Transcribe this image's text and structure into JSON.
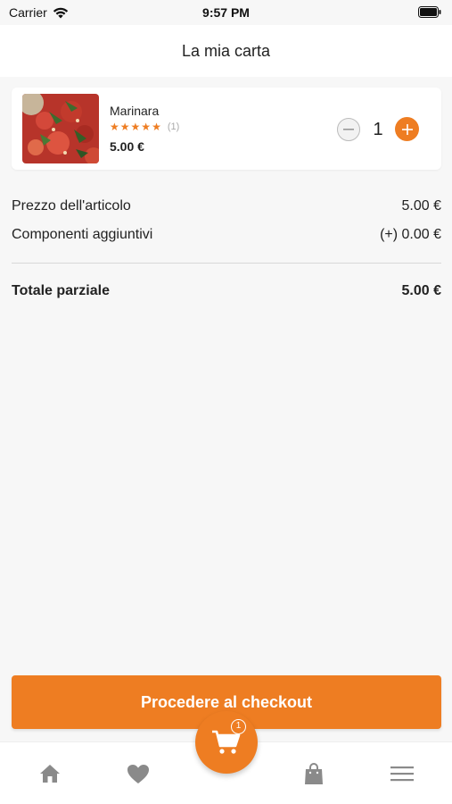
{
  "status_bar": {
    "carrier": "Carrier",
    "time": "9:57 PM"
  },
  "header": {
    "title": "La mia carta"
  },
  "cart_items": [
    {
      "name": "Marinara",
      "rating": 5,
      "reviews": "(1)",
      "price": "5.00 €",
      "quantity": "1"
    }
  ],
  "summary": {
    "item_price_label": "Prezzo dell'articolo",
    "item_price_value": "5.00 €",
    "extras_label": "Componenti aggiuntivi",
    "extras_value": "(+) 0.00 €",
    "subtotal_label": "Totale parziale",
    "subtotal_value": "5.00 €"
  },
  "checkout": {
    "label": "Procedere al checkout"
  },
  "tab_bar": {
    "items": [
      "home-icon",
      "heart-icon",
      "cart-icon",
      "shopping-bag-icon",
      "menu-icon"
    ],
    "cart_badge": "1"
  },
  "colors": {
    "accent": "#ee7d22",
    "tab_icon": "#8a8a8a",
    "background": "#f7f7f7"
  }
}
